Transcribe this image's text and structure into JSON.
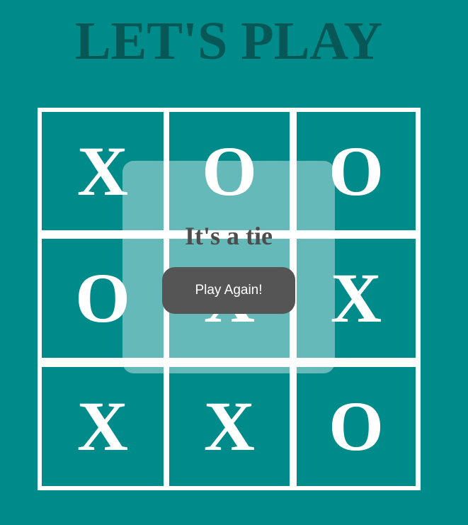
{
  "title": "LET'S PLAY",
  "board": {
    "cells": [
      [
        "X",
        "O",
        "O"
      ],
      [
        "O",
        "X",
        "X"
      ],
      [
        "X",
        "X",
        "O"
      ]
    ]
  },
  "result": {
    "message": "It's a tie",
    "button_label": "Play Again!"
  },
  "colors": {
    "background": "#008b8b",
    "title": "#075757",
    "grid_lines": "#ffffff",
    "marks": "#ffffff",
    "overlay": "rgba(255,255,255,0.40)",
    "message": "#4d4d4d",
    "button": "#555555"
  }
}
